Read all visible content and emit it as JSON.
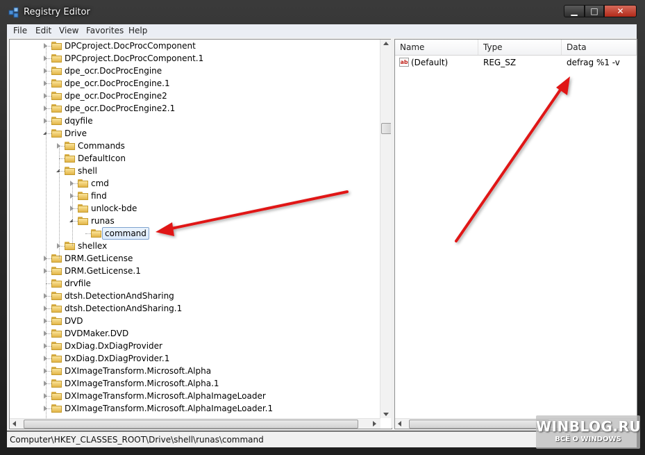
{
  "window": {
    "title": "Registry Editor",
    "min_glyph": "▁",
    "max_glyph": "□",
    "close_glyph": "✕"
  },
  "menu": [
    "File",
    "Edit",
    "View",
    "Favorites",
    "Help"
  ],
  "tree": {
    "items": [
      {
        "label": "DPCproject.DocProcComponent",
        "level": 0,
        "expander": "collapsed",
        "selected": false
      },
      {
        "label": "DPCproject.DocProcComponent.1",
        "level": 0,
        "expander": "collapsed",
        "selected": false
      },
      {
        "label": "dpe_ocr.DocProcEngine",
        "level": 0,
        "expander": "collapsed",
        "selected": false
      },
      {
        "label": "dpe_ocr.DocProcEngine.1",
        "level": 0,
        "expander": "collapsed",
        "selected": false
      },
      {
        "label": "dpe_ocr.DocProcEngine2",
        "level": 0,
        "expander": "collapsed",
        "selected": false
      },
      {
        "label": "dpe_ocr.DocProcEngine2.1",
        "level": 0,
        "expander": "collapsed",
        "selected": false
      },
      {
        "label": "dqyfile",
        "level": 0,
        "expander": "collapsed",
        "selected": false
      },
      {
        "label": "Drive",
        "level": 0,
        "expander": "expanded",
        "selected": false
      },
      {
        "label": "Commands",
        "level": 1,
        "expander": "collapsed",
        "selected": false
      },
      {
        "label": "DefaultIcon",
        "level": 1,
        "expander": "none",
        "selected": false
      },
      {
        "label": "shell",
        "level": 1,
        "expander": "expanded",
        "selected": false
      },
      {
        "label": "cmd",
        "level": 2,
        "expander": "collapsed",
        "selected": false
      },
      {
        "label": "find",
        "level": 2,
        "expander": "collapsed",
        "selected": false
      },
      {
        "label": "unlock-bde",
        "level": 2,
        "expander": "collapsed",
        "selected": false
      },
      {
        "label": "runas",
        "level": 2,
        "expander": "expanded",
        "selected": false
      },
      {
        "label": "command",
        "level": 3,
        "expander": "none",
        "selected": true
      },
      {
        "label": "shellex",
        "level": 1,
        "expander": "collapsed",
        "selected": false
      },
      {
        "label": "DRM.GetLicense",
        "level": 0,
        "expander": "collapsed",
        "selected": false
      },
      {
        "label": "DRM.GetLicense.1",
        "level": 0,
        "expander": "collapsed",
        "selected": false
      },
      {
        "label": "drvfile",
        "level": 0,
        "expander": "none",
        "selected": false
      },
      {
        "label": "dtsh.DetectionAndSharing",
        "level": 0,
        "expander": "collapsed",
        "selected": false
      },
      {
        "label": "dtsh.DetectionAndSharing.1",
        "level": 0,
        "expander": "collapsed",
        "selected": false
      },
      {
        "label": "DVD",
        "level": 0,
        "expander": "collapsed",
        "selected": false
      },
      {
        "label": "DVDMaker.DVD",
        "level": 0,
        "expander": "collapsed",
        "selected": false
      },
      {
        "label": "DxDiag.DxDiagProvider",
        "level": 0,
        "expander": "collapsed",
        "selected": false
      },
      {
        "label": "DxDiag.DxDiagProvider.1",
        "level": 0,
        "expander": "collapsed",
        "selected": false
      },
      {
        "label": "DXImageTransform.Microsoft.Alpha",
        "level": 0,
        "expander": "collapsed",
        "selected": false
      },
      {
        "label": "DXImageTransform.Microsoft.Alpha.1",
        "level": 0,
        "expander": "collapsed",
        "selected": false
      },
      {
        "label": "DXImageTransform.Microsoft.AlphaImageLoader",
        "level": 0,
        "expander": "collapsed",
        "selected": false
      },
      {
        "label": "DXImageTransform.Microsoft.AlphaImageLoader.1",
        "level": 0,
        "expander": "collapsed",
        "selected": false
      }
    ]
  },
  "list": {
    "columns": [
      "Name",
      "Type",
      "Data"
    ],
    "rows": [
      {
        "icon": "string-value-icon",
        "icon_text": "ab",
        "name": "(Default)",
        "type": "REG_SZ",
        "data": "defrag %1 -v"
      }
    ]
  },
  "status": {
    "path": "Computer\\HKEY_CLASSES_ROOT\\Drive\\shell\\runas\\command"
  },
  "watermark": {
    "main": "WINBLOG.RU",
    "sub": "ВСЁ О WINDOWS"
  },
  "annotation_color": "#e01818"
}
